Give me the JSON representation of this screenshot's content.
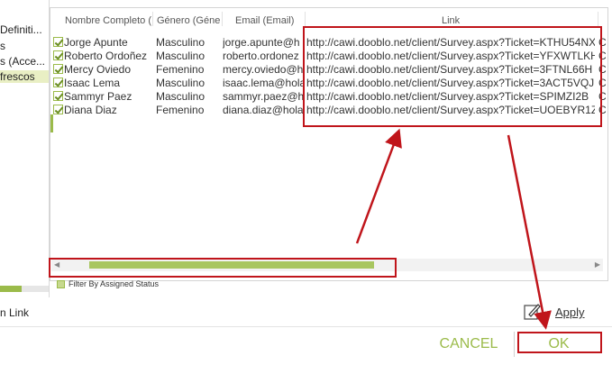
{
  "left_pane": {
    "items": [
      "Definiti...",
      "s",
      "s (Acce...",
      "frescos"
    ],
    "link_label": "n Link"
  },
  "grid": {
    "headers": [
      "Nombre Completo (",
      "Género (Géne",
      "Email (Email)",
      "Link"
    ],
    "rows": [
      {
        "name": "Jorge Apunte",
        "gender": "Masculino",
        "email": "jorge.apunte@h",
        "link": "http://cawi.dooblo.net/client/Survey.aspx?Ticket=KTHU54NX",
        "extra": "C"
      },
      {
        "name": "Roberto Ordoñez",
        "gender": "Masculino",
        "email": "roberto.ordonez",
        "link": "http://cawi.dooblo.net/client/Survey.aspx?Ticket=YFXWTLKH",
        "extra": "C"
      },
      {
        "name": "Mercy Oviedo",
        "gender": "Femenino",
        "email": "mercy.oviedo@h",
        "link": "http://cawi.dooblo.net/client/Survey.aspx?Ticket=3FTNL66H",
        "extra": "C"
      },
      {
        "name": "Isaac Lema",
        "gender": "Masculino",
        "email": "isaac.lema@hola",
        "link": "http://cawi.dooblo.net/client/Survey.aspx?Ticket=3ACT5VQJ",
        "extra": "C"
      },
      {
        "name": "Sammyr Paez",
        "gender": "Masculino",
        "email": "sammyr.paez@h",
        "link": "http://cawi.dooblo.net/client/Survey.aspx?Ticket=SPIMZI2B",
        "extra": "C"
      },
      {
        "name": "Diana Diaz",
        "gender": "Femenino",
        "email": "diana.diaz@hola",
        "link": "http://cawi.dooblo.net/client/Survey.aspx?Ticket=UOEBYR1Z",
        "extra": "C"
      }
    ]
  },
  "filter": {
    "label": "Filter By Assigned Status"
  },
  "apply": {
    "label": "Apply"
  },
  "buttons": {
    "cancel": "CANCEL",
    "ok": "OK"
  },
  "colors": {
    "accent": "#9bbb4a",
    "annotation": "#c0151b"
  }
}
